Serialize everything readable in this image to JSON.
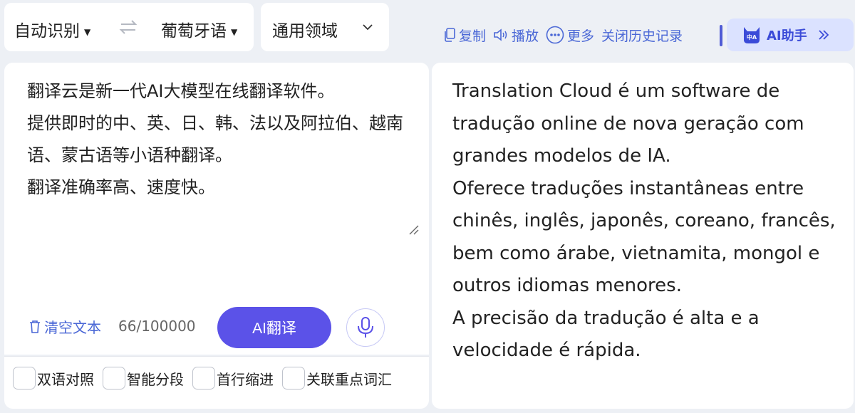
{
  "language_bar": {
    "source_language": "自动识别",
    "target_language": "葡萄牙语"
  },
  "domain_select": {
    "label": "通用领域"
  },
  "output_actions": {
    "copy": "复制",
    "play": "播放",
    "more": "更多",
    "close_history": "关闭历史记录"
  },
  "ai_assistant": {
    "label": "AI助手",
    "avatar_text": "中A"
  },
  "source": {
    "text": "翻译云是新一代AI大模型在线翻译软件。\n提供即时的中、英、日、韩、法以及阿拉伯、越南语、蒙古语等小语种翻译。\n翻译准确率高、速度快。",
    "clear_label": "清空文本",
    "char_count": "66/100000",
    "translate_button": "AI翻译"
  },
  "options": [
    {
      "label": "双语对照",
      "checked": false
    },
    {
      "label": "智能分段",
      "checked": false
    },
    {
      "label": "首行缩进",
      "checked": false
    },
    {
      "label": "关联重点词汇",
      "checked": false
    }
  ],
  "translation": {
    "text": "Translation Cloud é um software de tradução online de nova geração com grandes modelos de IA.\nOferece traduções instantâneas entre chinês, inglês, japonês, coreano, francês, bem como árabe, vietnamita, mongol e outros idiomas menores.\nA precisão da tradução é alta e a velocidade é rápida."
  },
  "colors": {
    "accent": "#5b52e8",
    "link": "#4a67d6",
    "background": "#edf0f5"
  }
}
